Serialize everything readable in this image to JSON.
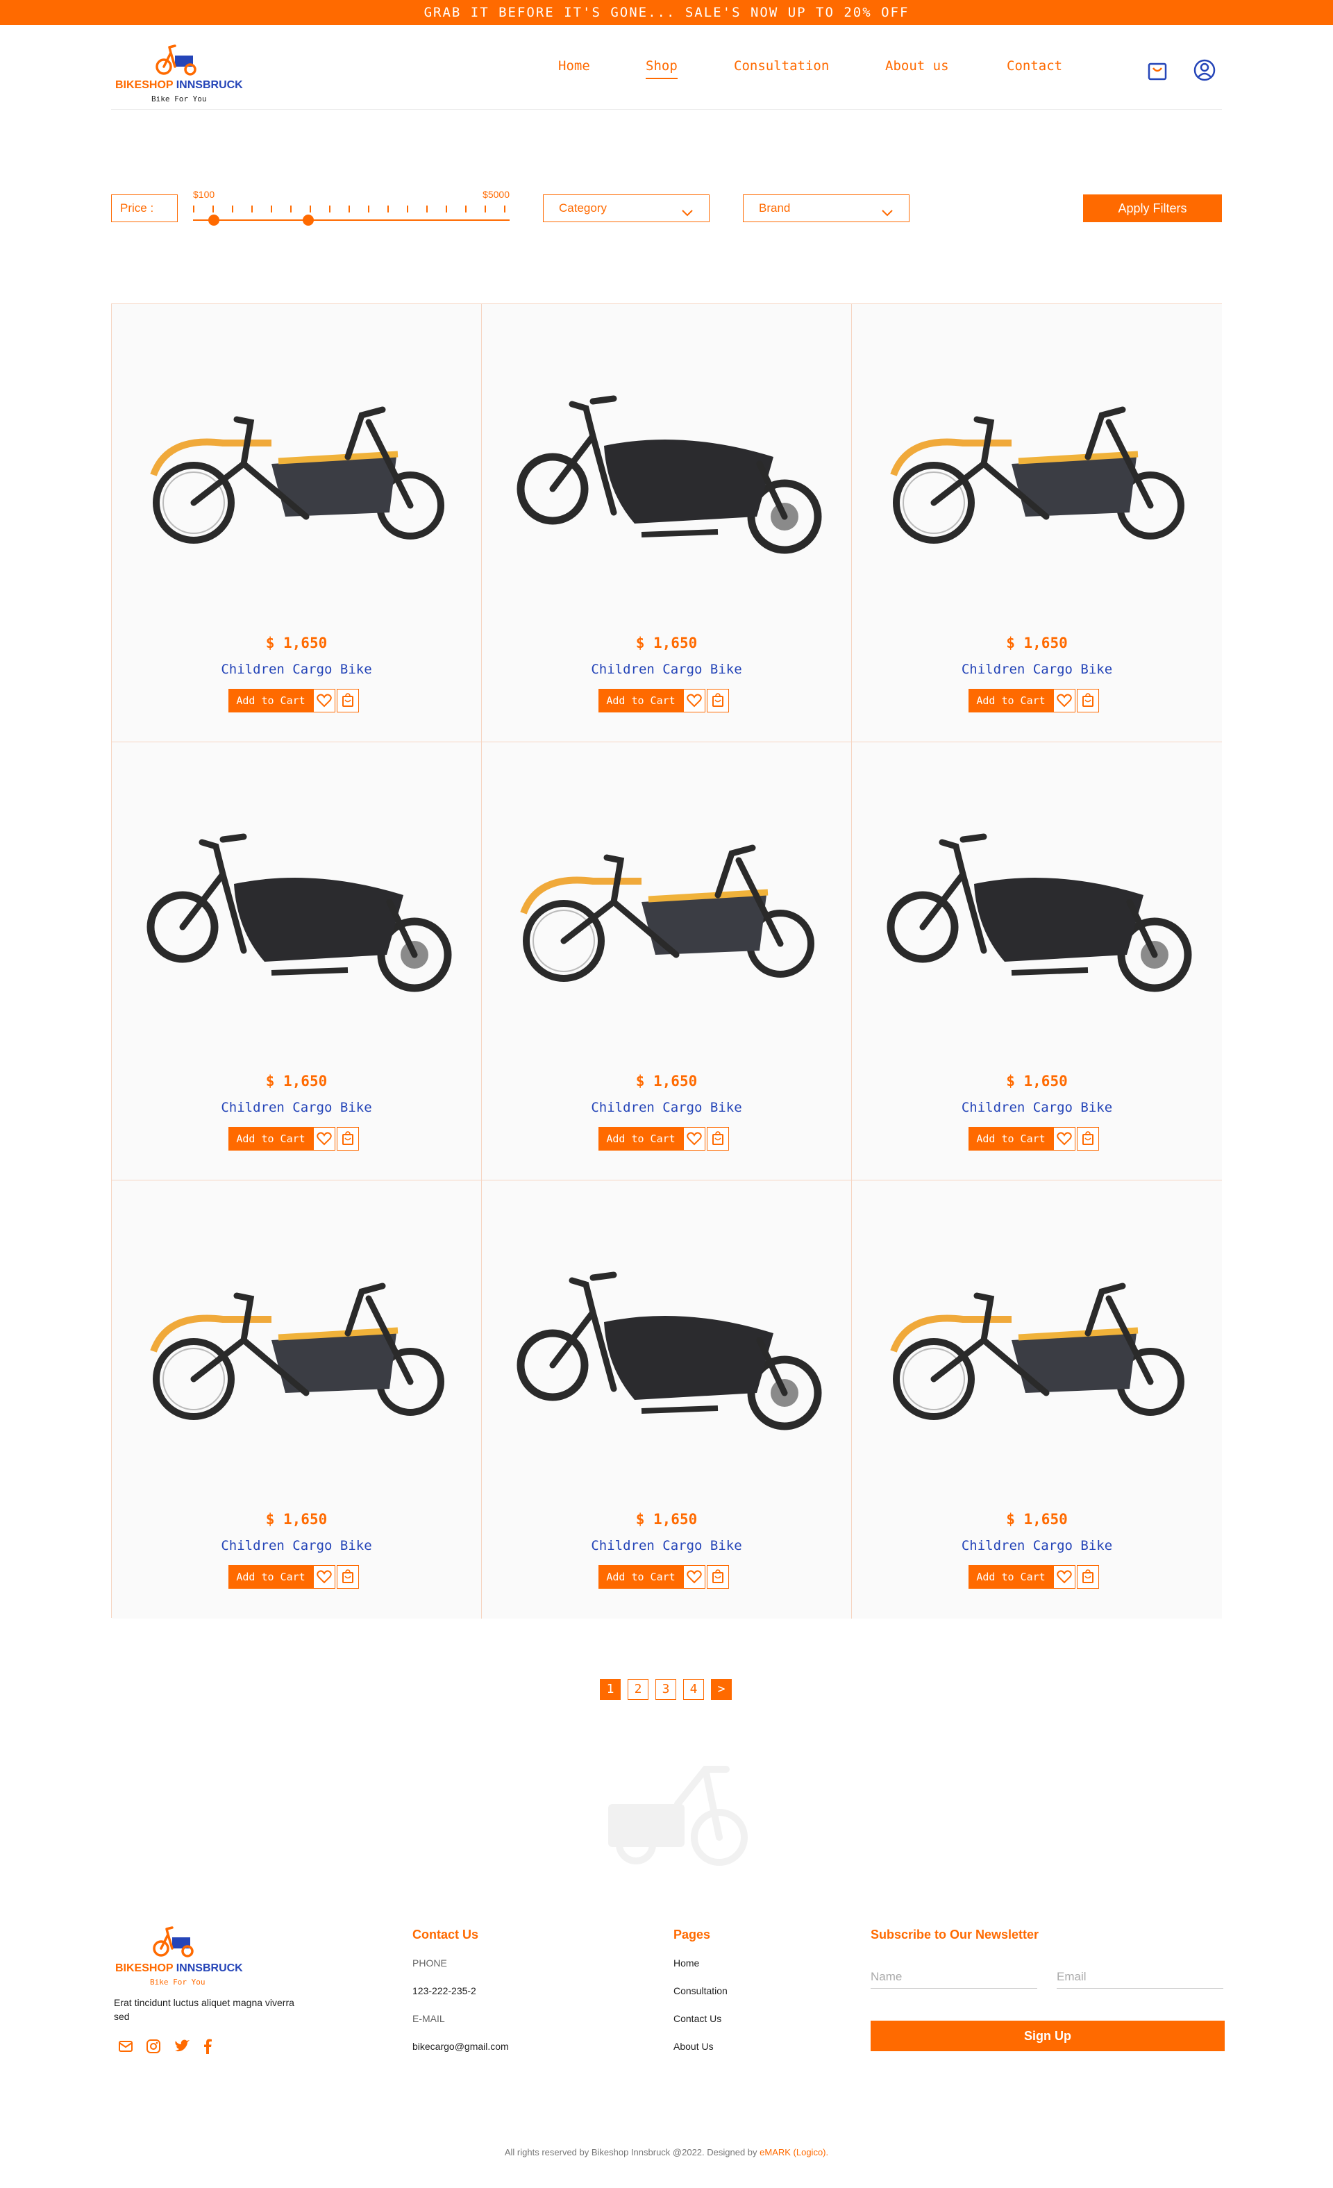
{
  "announcement": "GRAB IT BEFORE IT'S GONE... SALE'S NOW UP TO 20% OFF",
  "brand": {
    "name_part1": "BIKESHOP ",
    "name_part2": "INNSBRUCK",
    "tagline": "Bike For You"
  },
  "nav": {
    "items": [
      "Home",
      "Shop",
      "Consultation",
      "About us",
      "Contact"
    ],
    "active": "Shop"
  },
  "header_icons": [
    "shopping-bag-icon",
    "user-icon"
  ],
  "filters": {
    "price_label": "Price :",
    "price_min": "$100",
    "price_max": "$5000",
    "category_label": "Category",
    "brand_label": "Brand",
    "apply_label": "Apply Filters"
  },
  "products": [
    {
      "price": "$ 1,650",
      "name": "Children Cargo Bike",
      "cart_label": "Add to Cart",
      "variant": "long"
    },
    {
      "price": "$ 1,650",
      "name": "Children Cargo Bike",
      "cart_label": "Add to Cart",
      "variant": "box"
    },
    {
      "price": "$ 1,650",
      "name": "Children Cargo Bike",
      "cart_label": "Add to Cart",
      "variant": "long"
    },
    {
      "price": "$ 1,650",
      "name": "Children Cargo Bike",
      "cart_label": "Add to Cart",
      "variant": "box"
    },
    {
      "price": "$ 1,650",
      "name": "Children Cargo Bike",
      "cart_label": "Add to Cart",
      "variant": "long"
    },
    {
      "price": "$ 1,650",
      "name": "Children Cargo Bike",
      "cart_label": "Add to Cart",
      "variant": "box"
    },
    {
      "price": "$ 1,650",
      "name": "Children Cargo Bike",
      "cart_label": "Add to Cart",
      "variant": "long"
    },
    {
      "price": "$ 1,650",
      "name": "Children Cargo Bike",
      "cart_label": "Add to Cart",
      "variant": "box"
    },
    {
      "price": "$ 1,650",
      "name": "Children Cargo Bike",
      "cart_label": "Add to Cart",
      "variant": "long"
    }
  ],
  "pagination": {
    "pages": [
      "1",
      "2",
      "3",
      "4"
    ],
    "current": "1",
    "next": ">"
  },
  "footer": {
    "description": "Erat tincidunt luctus aliquet magna viverra sed",
    "social_icons": [
      "mail-icon",
      "instagram-icon",
      "twitter-icon",
      "facebook-icon"
    ],
    "contact": {
      "title": "Contact Us",
      "phone_label": "PHONE",
      "phone": "123-222-235-2",
      "email_label": "E-MAIL",
      "email": "bikecargo@gmail.com"
    },
    "pages": {
      "title": "Pages",
      "items": [
        "Home",
        "Consultation",
        "Contact Us",
        "About Us"
      ]
    },
    "newsletter": {
      "title": "Subscribe to Our Newsletter",
      "name_placeholder": "Name",
      "email_placeholder": "Email",
      "button": "Sign Up"
    },
    "copyright": "All rights reserved by Bikeshop Innsbruck @2022. Designed by ",
    "designer": "eMARK (Logico)."
  },
  "colors": {
    "accent": "#ff6a00",
    "blue": "#2545b8"
  }
}
